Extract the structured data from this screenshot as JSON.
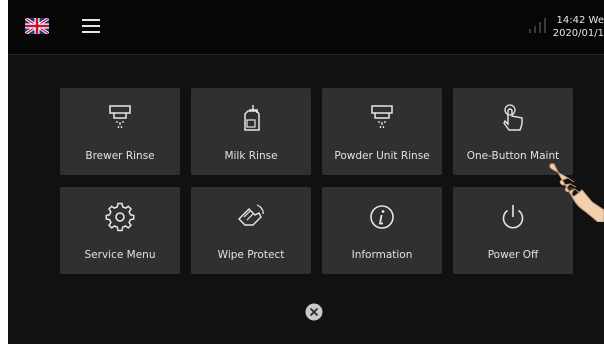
{
  "topbar": {
    "flag_icon": "uk-flag-icon",
    "menu_icon": "hamburger-menu-icon",
    "signal_icon": "signal-bars-icon",
    "clock_time": "14:42 We",
    "clock_date": "2020/01/1"
  },
  "tiles": [
    {
      "label": "Brewer Rinse",
      "icon": "brewer-rinse-icon"
    },
    {
      "label": "Milk Rinse",
      "icon": "milk-rinse-icon"
    },
    {
      "label": "Powder Unit Rinse",
      "icon": "powder-unit-rinse-icon"
    },
    {
      "label": "One-Button Maint",
      "icon": "touch-hand-icon"
    },
    {
      "label": "Service Menu",
      "icon": "gear-icon"
    },
    {
      "label": "Wipe Protect",
      "icon": "wipe-hand-icon"
    },
    {
      "label": "Information",
      "icon": "info-icon"
    },
    {
      "label": "Power Off",
      "icon": "power-icon"
    }
  ],
  "footer": {
    "close_icon": "close-circle-icon"
  },
  "colors": {
    "screen_bg": "#111111",
    "tile_bg": "#303030",
    "text": "#e2e2e2"
  }
}
